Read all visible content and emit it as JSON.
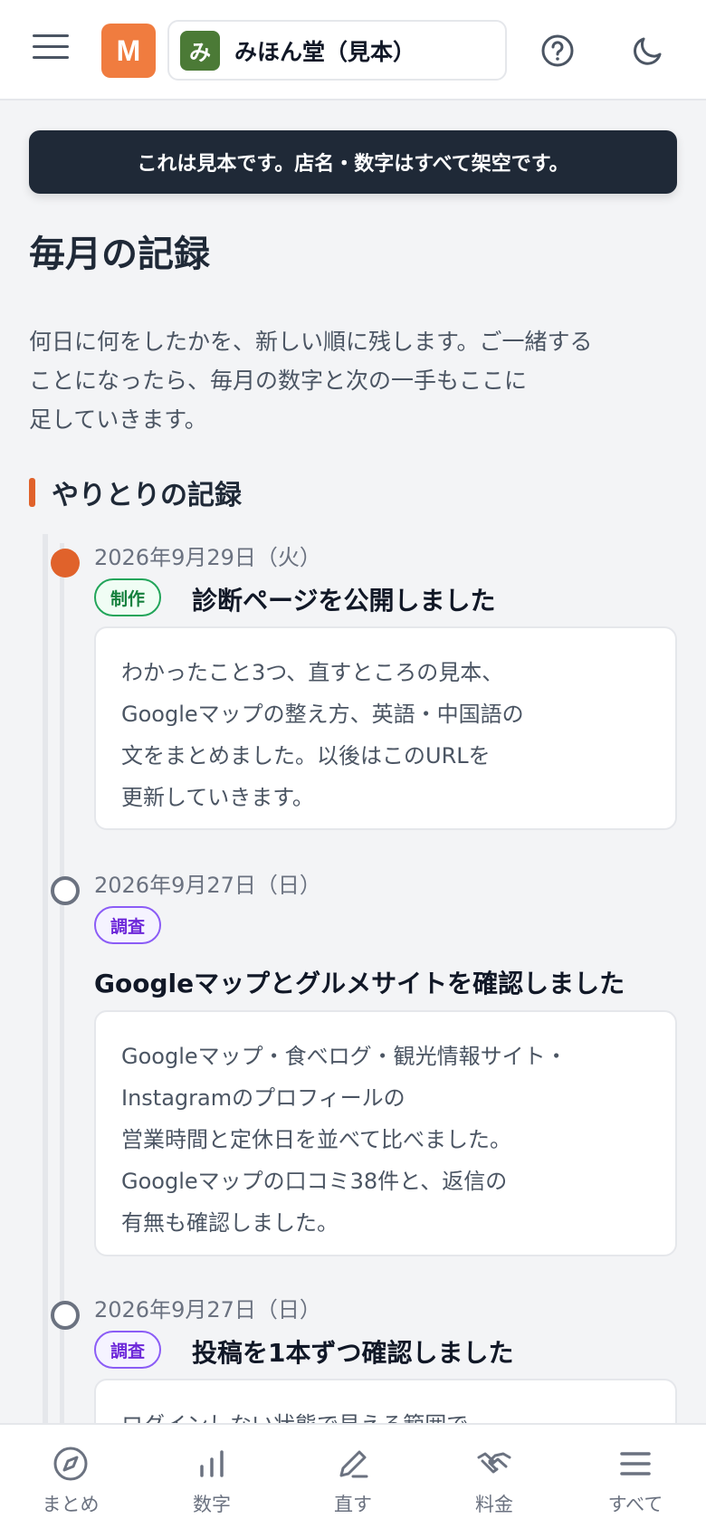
{
  "header": {
    "avatar_letter": "M",
    "shop_icon_letter": "み",
    "shop_name": "みほん堂（見本）"
  },
  "banner": "これは見本です。店名・数字はすべて架空です。",
  "page_title": "毎月の記録",
  "intro_lines": [
    "何日に何をしたかを、新しい順に残します。ご一緒する",
    "ことになったら、毎月の数字と次の一手もここに",
    "足していきます。"
  ],
  "section_title": "やりとりの記録",
  "entries": [
    {
      "date": "2026年9月29日（火）",
      "tag": "制作",
      "tag_color": "#15803d",
      "title": "診断ページを公開しました",
      "body": [
        "わかったこと3つ、直すところの見本、",
        "Googleマップの整え方、英語・中国語の",
        "文をまとめました。以後はこのURLを",
        "更新していきます。"
      ]
    },
    {
      "date": "2026年9月27日（日）",
      "tag": "調査",
      "tag_color": "#6d28d9",
      "title": "Googleマップとグルメサイトを確認しました",
      "body": [
        "Googleマップ・食べログ・観光情報サイト・",
        "Instagramのプロフィールの",
        "営業時間と定休日を並べて比べました。",
        "Googleマップの口コミ38件と、返信の",
        "有無も確認しました。"
      ]
    },
    {
      "date": "2026年9月27日（日）",
      "tag": "調査",
      "tag_color": "#6d28d9",
      "title": "投稿を1本ずつ確認しました",
      "body": [
        "ログインしない状態で見える範囲で"
      ]
    }
  ],
  "bottom_nav": [
    {
      "label": "まとめ",
      "icon": "compass-icon"
    },
    {
      "label": "数字",
      "icon": "bar-chart-icon"
    },
    {
      "label": "直す",
      "icon": "pen-icon"
    },
    {
      "label": "料金",
      "icon": "handshake-icon"
    },
    {
      "label": "すべて",
      "icon": "menu-icon"
    }
  ]
}
